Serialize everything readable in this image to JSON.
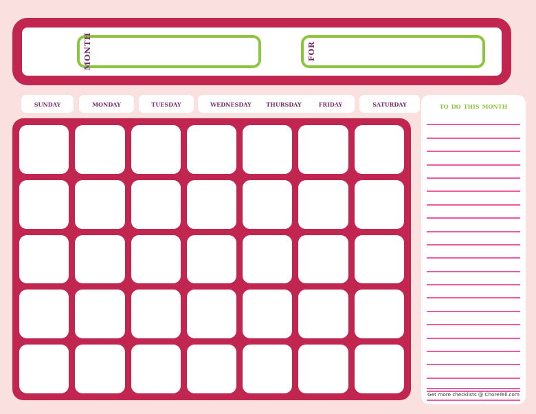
{
  "page": {
    "background_color": "#fae0de",
    "accent_crimson": "#c0264f",
    "accent_green": "#8cc63e",
    "accent_purple": "#7b2d6b",
    "accent_pink_rule": "#ee5b9e"
  },
  "header": {
    "month_field": {
      "label": "MONTH",
      "value": "",
      "placeholder": ""
    },
    "for_field": {
      "label": "FOR",
      "value": "",
      "placeholder": ""
    }
  },
  "weekdays": [
    {
      "label": "sunday"
    },
    {
      "label": "monday"
    },
    {
      "label": "tuesday"
    },
    {
      "label": "wednesday"
    },
    {
      "label": "thursday"
    },
    {
      "label": "friday"
    },
    {
      "label": "saturday"
    }
  ],
  "calendar": {
    "rows": 5,
    "columns": 7,
    "total_cells": 35,
    "cells": [
      "",
      "",
      "",
      "",
      "",
      "",
      "",
      "",
      "",
      "",
      "",
      "",
      "",
      "",
      "",
      "",
      "",
      "",
      "",
      "",
      "",
      "",
      "",
      "",
      "",
      "",
      "",
      "",
      "",
      "",
      "",
      "",
      "",
      "",
      ""
    ]
  },
  "todo": {
    "title": "to do this month",
    "line_count": 23,
    "lines": [
      "",
      "",
      "",
      "",
      "",
      "",
      "",
      "",
      "",
      "",
      "",
      "",
      "",
      "",
      "",
      "",
      "",
      "",
      "",
      "",
      "",
      "",
      ""
    ],
    "credit": "Get more checklists @ ChoreTell.com"
  }
}
